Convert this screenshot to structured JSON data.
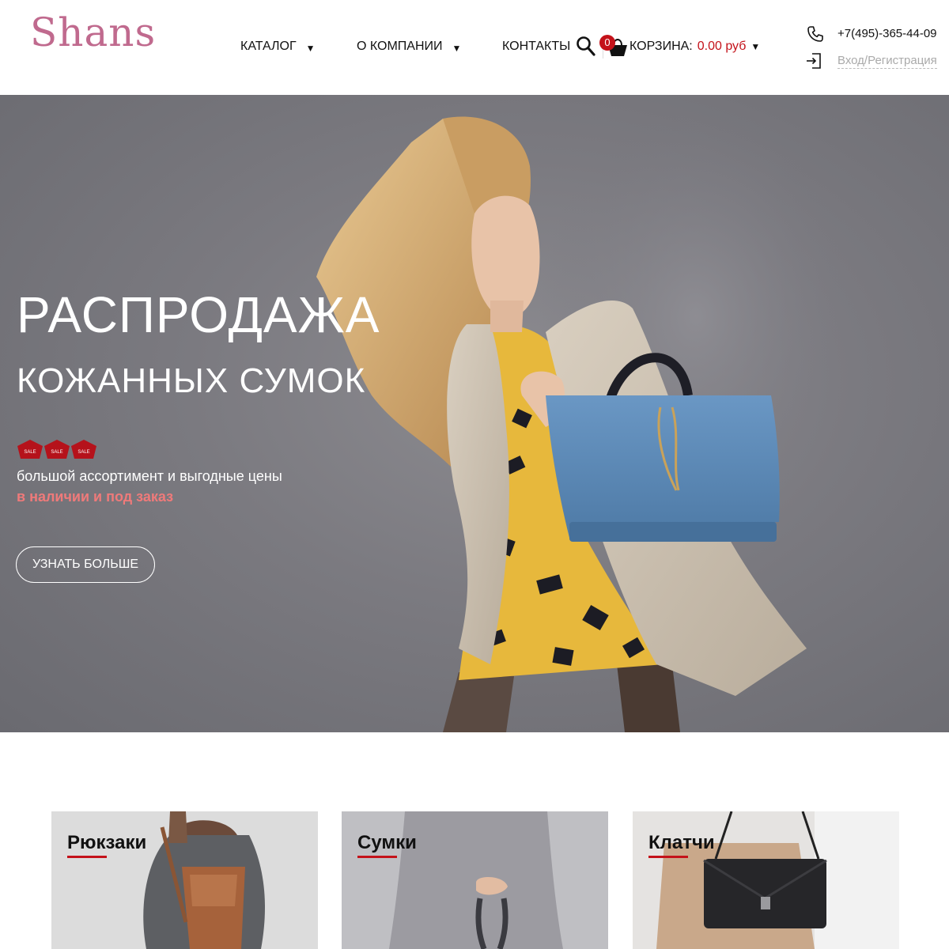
{
  "header": {
    "logo": "Shans",
    "nav": [
      {
        "label": "КАТАЛОГ",
        "arrow": "▼"
      },
      {
        "label": "О КОМПАНИИ",
        "arrow": "▼"
      },
      {
        "label": "КОНТАКТЫ"
      }
    ],
    "cart": {
      "count": "0",
      "label": "КОРЗИНА:",
      "sum": "0.00 руб",
      "arrow": "▼"
    },
    "phone": "+7(495)-365-44-09",
    "login": "Вход/Регистрация",
    "icons": [
      "search-icon",
      "cart-icon",
      "phone-icon",
      "login-icon"
    ]
  },
  "hero": {
    "title": "РАСПРОДАЖА",
    "subtitle": "КОЖАННЫХ СУМОК",
    "sale_tag": "SALE",
    "description": "большой ассортимент и выгодные цены",
    "accent": "в наличии и под заказ",
    "button": "УЗНАТЬ БОЛЬШЕ"
  },
  "categories": [
    {
      "title": "Рюкзаки"
    },
    {
      "title": "Сумки"
    },
    {
      "title": "Клатчи"
    }
  ],
  "colors": {
    "logo": "#c06a8e",
    "accent_red": "#c4121a",
    "hero_accent": "#ef7a7a",
    "hero_bg": "#7b7a80"
  }
}
